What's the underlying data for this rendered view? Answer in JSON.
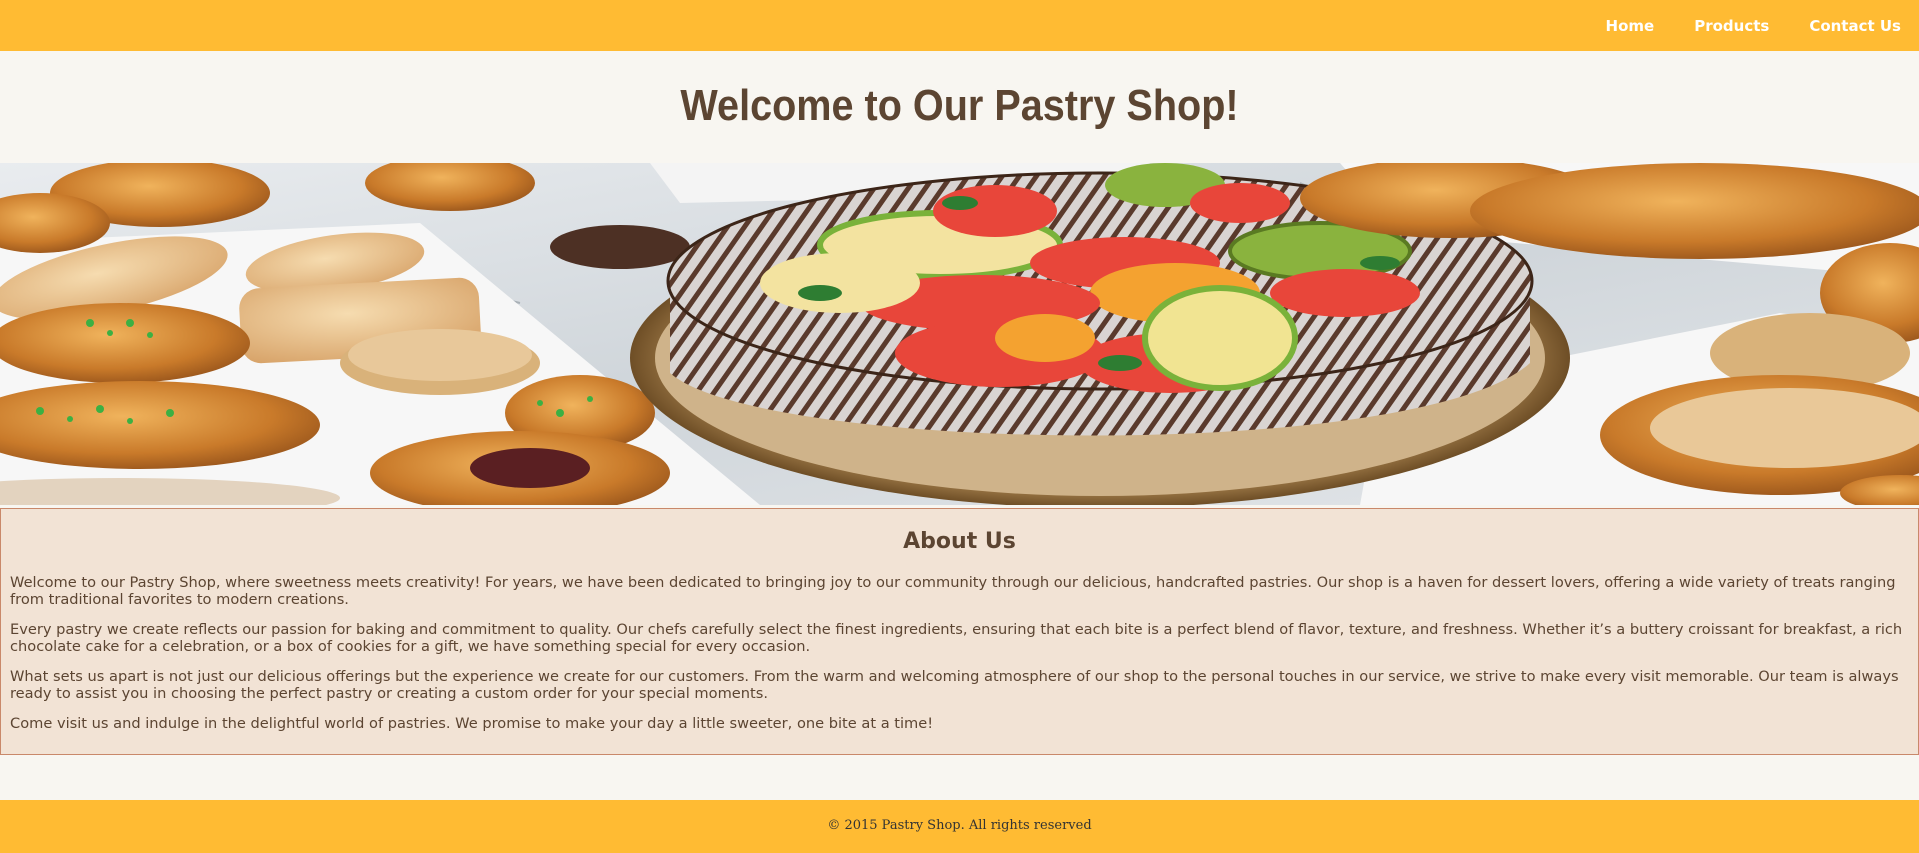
{
  "nav": {
    "links": [
      "Home",
      "Products",
      "Contact Us"
    ]
  },
  "header": {
    "title": "Welcome to Our Pastry Shop!"
  },
  "about": {
    "title": "About Us",
    "paragraphs": [
      "Welcome to our Pastry Shop, where sweetness meets creativity! For years, we have been dedicated to bringing joy to our community through our delicious, handcrafted pastries. Our shop is a haven for dessert lovers, offering a wide variety of treats ranging from traditional favorites to modern creations.",
      "Every pastry we create reflects our passion for baking and commitment to quality. Our chefs carefully select the finest ingredients, ensuring that each bite is a perfect blend of flavor, texture, and freshness. Whether it’s a buttery croissant for breakfast, a rich chocolate cake for a celebration, or a box of cookies for a gift, we have something special for every occasion.",
      "What sets us apart is not just our delicious offerings but the experience we create for our customers. From the warm and welcoming atmosphere of our shop to the personal touches in our service, we strive to make every visit memorable. Our team is always ready to assist you in choosing the perfect pastry or creating a custom order for your special moments.",
      "Come visit us and indulge in the delightful world of pastries. We promise to make your day a little sweeter, one bite at a time!"
    ]
  },
  "footer": {
    "copyright": "© 2015 Pastry Shop. All rights reserved"
  },
  "colors": {
    "nav_bar": "#ffbb33",
    "page_background": "#f8f6f1",
    "heading_brown": "#5c4532",
    "about_background": "#f2e3d5",
    "about_border": "#c9886a",
    "footer_bar": "#ffbb33"
  }
}
